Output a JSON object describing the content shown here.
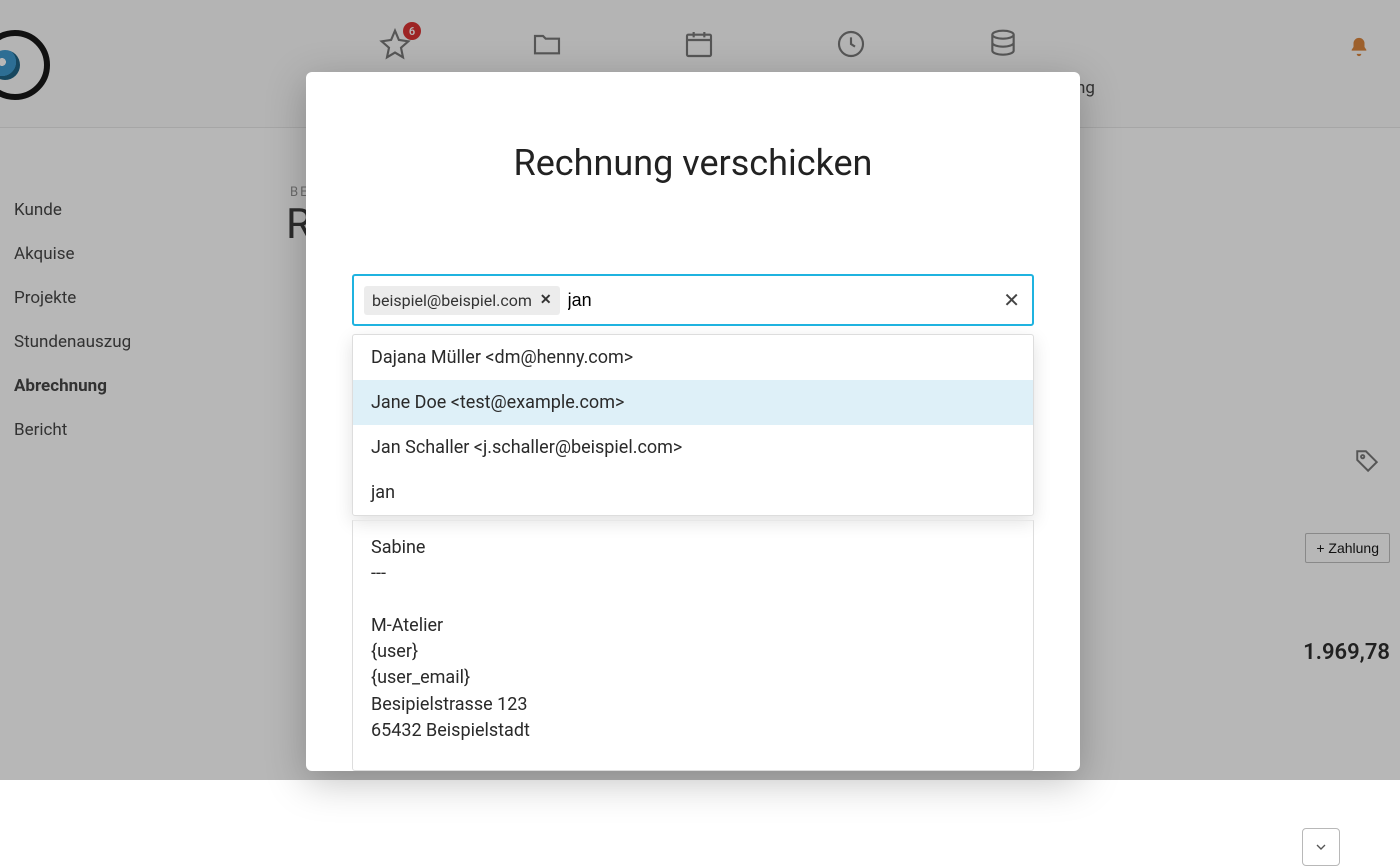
{
  "header": {
    "badge_count": "6"
  },
  "sidebar": {
    "items": [
      {
        "label": "Kunde"
      },
      {
        "label": "Akquise"
      },
      {
        "label": "Projekte"
      },
      {
        "label": "Stundenauszug"
      },
      {
        "label": "Abrechnung",
        "active": true
      },
      {
        "label": "Bericht"
      }
    ]
  },
  "page": {
    "breadcrumb_prefix": "BE",
    "title_prefix": "R",
    "nav_fragment": "ng",
    "add_payment_label": "+ Zahlung",
    "amount": "1.969,78"
  },
  "modal": {
    "title": "Rechnung verschicken",
    "recipient": {
      "chips": [
        "beispiel@beispiel.com"
      ],
      "input_value": "jan"
    },
    "autocomplete": [
      {
        "label": "Dajana Müller <dm@henny.com>"
      },
      {
        "label": "Jane Doe <test@example.com>",
        "highlighted": true
      },
      {
        "label": "Jan Schaller <j.schaller@beispiel.com>"
      },
      {
        "label": "jan"
      }
    ],
    "body_preview": "Sabine\n---\n\nM-Atelier\n{user}\n{user_email}\nBesipielstrasse 123\n65432 Beispielstadt"
  }
}
